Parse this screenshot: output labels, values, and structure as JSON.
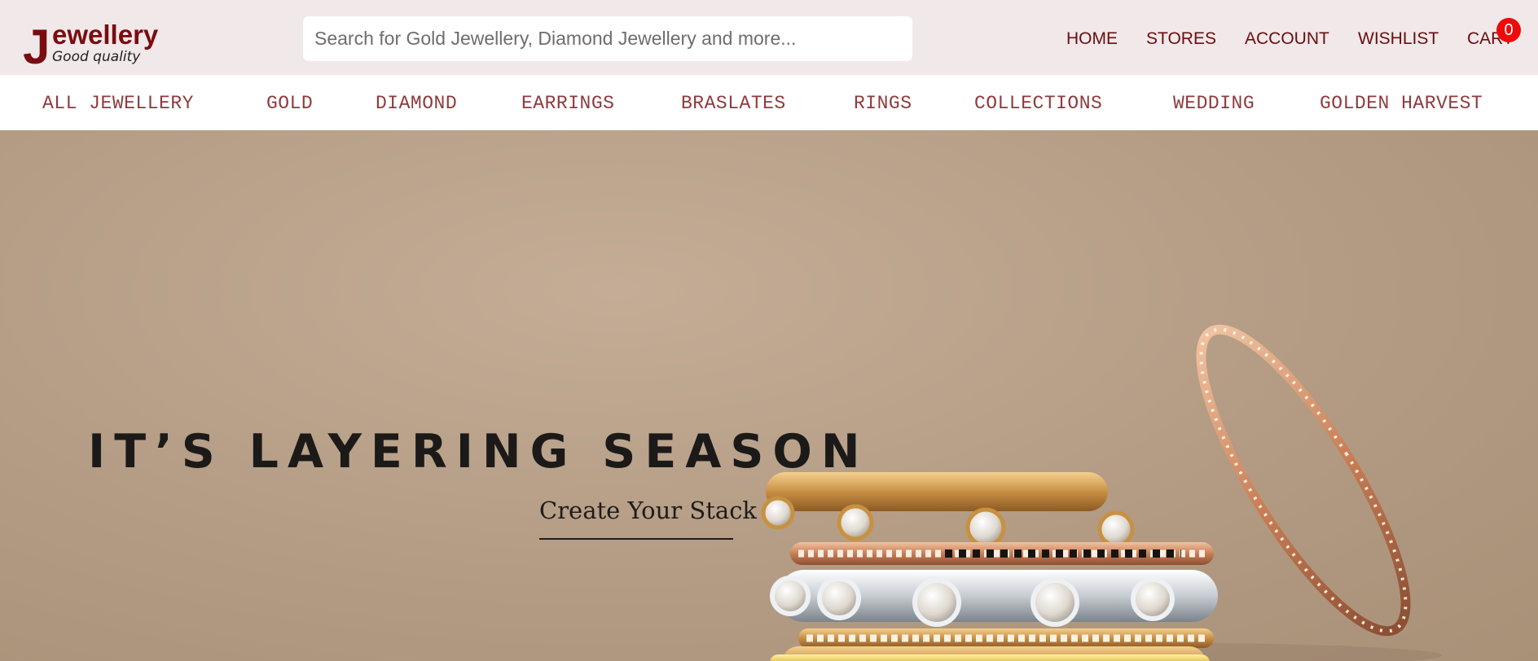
{
  "logo": {
    "initial": "J",
    "word": "ewellery",
    "tagline": "Good quality"
  },
  "search": {
    "placeholder": "Search for Gold Jewellery, Diamond Jewellery and more...",
    "value": ""
  },
  "topnav": {
    "home": "HOME",
    "stores": "STORES",
    "account": "ACCOUNT",
    "wishlist": "WISHLIST",
    "cart": "CART",
    "cart_count": "0"
  },
  "categories": {
    "all": "ALL JEWELLERY",
    "gold": "GOLD",
    "diamond": "DIAMOND",
    "earrings": "EARRINGS",
    "braslates": "BRASLATES",
    "rings": "RINGS",
    "collections": "COLLECTIONS",
    "wedding": "WEDDING",
    "golden_harvest": "GOLDEN HARVEST"
  },
  "hero": {
    "title": "IT’S LAYERING SEASON",
    "cta": "Create Your Stack",
    "image": "stacked-rings-image"
  },
  "colors": {
    "brand": "#7a0c10",
    "header_bg": "#f1e9e9",
    "nav_text": "#6b0c10",
    "category_text": "#8e3a3d",
    "badge": "#ee0b0b",
    "hero_bg": "#b49d86"
  }
}
